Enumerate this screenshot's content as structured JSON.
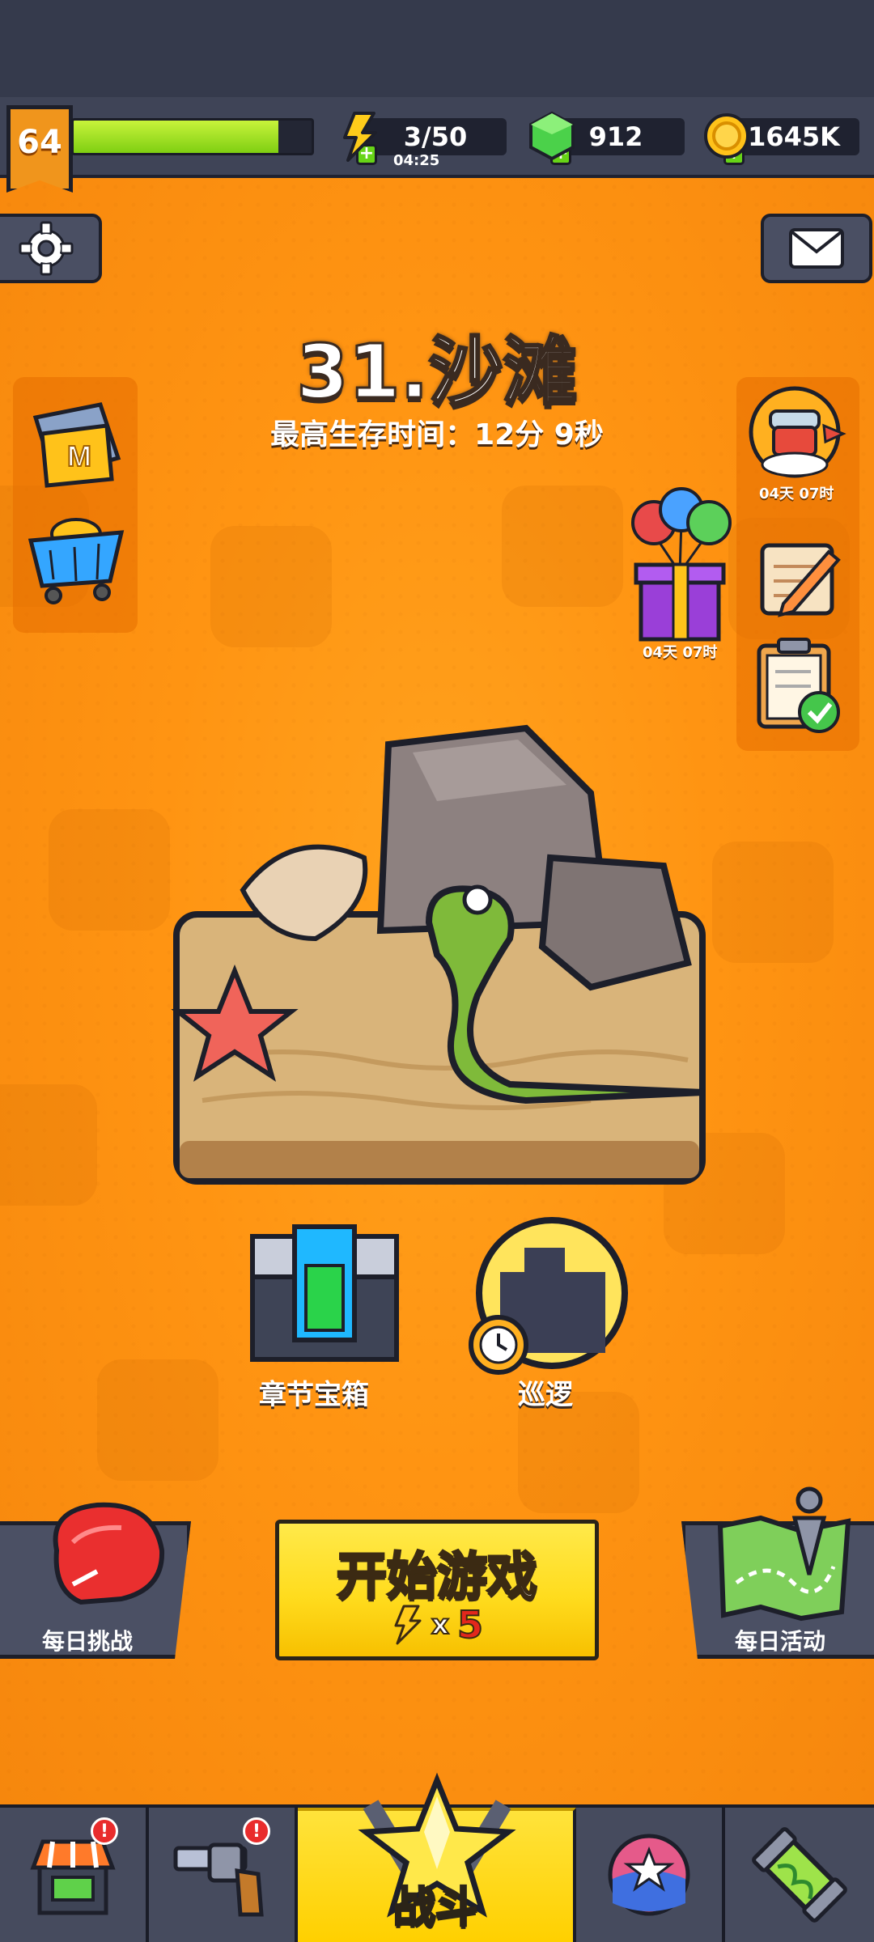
{
  "player": {
    "level": "64",
    "xp_progress": 0.86
  },
  "resources": {
    "energy": {
      "icon": "lightning-icon",
      "value": "3/50",
      "timer": "04:25"
    },
    "gems": {
      "icon": "green-gem-icon",
      "value": "912"
    },
    "coins": {
      "icon": "gold-coin-icon",
      "value": "1645K"
    }
  },
  "stage": {
    "title": "31.沙滩",
    "best_time": "最高生存时间：12分 9秒"
  },
  "side_timers": {
    "hero_event": "04天 07时",
    "gift_event": "04天 07时"
  },
  "features": {
    "chapter_chest": "章节宝箱",
    "patrol": "巡逻"
  },
  "actions": {
    "daily_challenge": "每日挑战",
    "start_game": "开始游戏",
    "start_cost_x": "x",
    "start_cost_n": "5",
    "daily_event": "每日活动"
  },
  "nav": {
    "shop_badge": "!",
    "weapon_badge": "!",
    "battle_label": "战斗"
  },
  "colors": {
    "accent": "#ff9412",
    "xp_green": "#9be21a",
    "start_yellow": "#ffdc1e",
    "panel_dark": "#3f4457"
  }
}
